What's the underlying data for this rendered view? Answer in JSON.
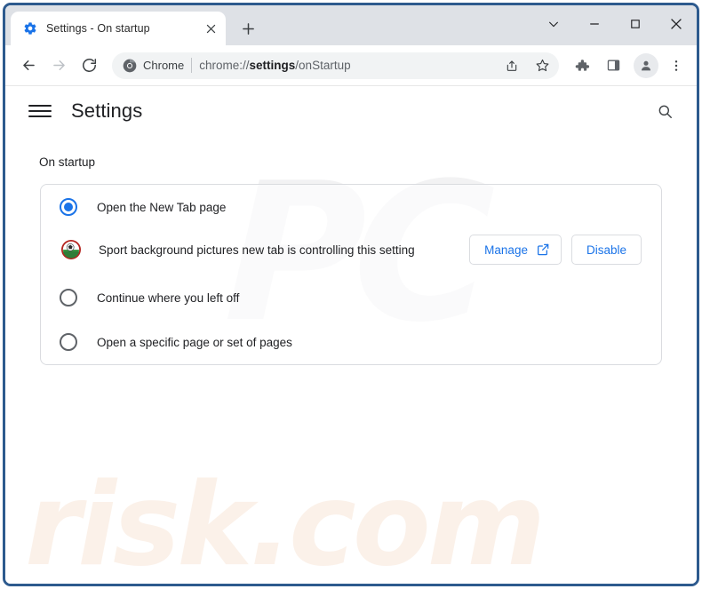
{
  "window": {
    "controls": {
      "tab_search_label": "Search tabs",
      "minimize_label": "Minimize",
      "maximize_label": "Maximize",
      "close_label": "Close"
    }
  },
  "tabstrip": {
    "tabs": [
      {
        "title": "Settings - On startup",
        "favicon": "gear-icon",
        "close_label": "Close tab"
      }
    ],
    "new_tab_label": "New tab"
  },
  "toolbar": {
    "back_label": "Back",
    "forward_label": "Forward",
    "reload_label": "Reload",
    "omnibox": {
      "chip_label": "Chrome",
      "chip_icon": "chrome-logo-icon",
      "url_prefix": "chrome://",
      "url_bold": "settings",
      "url_suffix": "/onStartup",
      "url_full": "chrome://settings/onStartup",
      "share_label": "Share this page",
      "bookmark_label": "Bookmark this tab"
    },
    "extensions_label": "Extensions",
    "side_panel_label": "Side panel",
    "profile_label": "Profile",
    "menu_label": "Customize and control Google Chrome"
  },
  "settings": {
    "menu_label": "Main menu",
    "title": "Settings",
    "search_label": "Search settings",
    "section_label": "On startup",
    "options": [
      {
        "label": "Open the New Tab page",
        "checked": true,
        "name": "open-new-tab-page"
      },
      {
        "label": "Continue where you left off",
        "checked": false,
        "name": "continue-where-you-left-off"
      },
      {
        "label": "Open a specific page or set of pages",
        "checked": false,
        "name": "open-specific-pages"
      }
    ],
    "controlled_notice": {
      "extension_icon": "soccer-ball-extension-icon",
      "text": "Sport background pictures new tab is controlling this setting",
      "manage_button": "Manage",
      "manage_icon": "open-in-new-icon",
      "disable_button": "Disable"
    }
  },
  "watermark": {
    "top": "PC",
    "bottom": "risk.com"
  },
  "colors": {
    "accent_blue": "#1a73e8",
    "frame_border": "#2d5a8e",
    "tabstrip_bg": "#dee1e6",
    "omnibox_bg": "#f1f3f4",
    "card_border": "#dadce0",
    "text_primary": "#202124",
    "text_secondary": "#5f6368"
  }
}
